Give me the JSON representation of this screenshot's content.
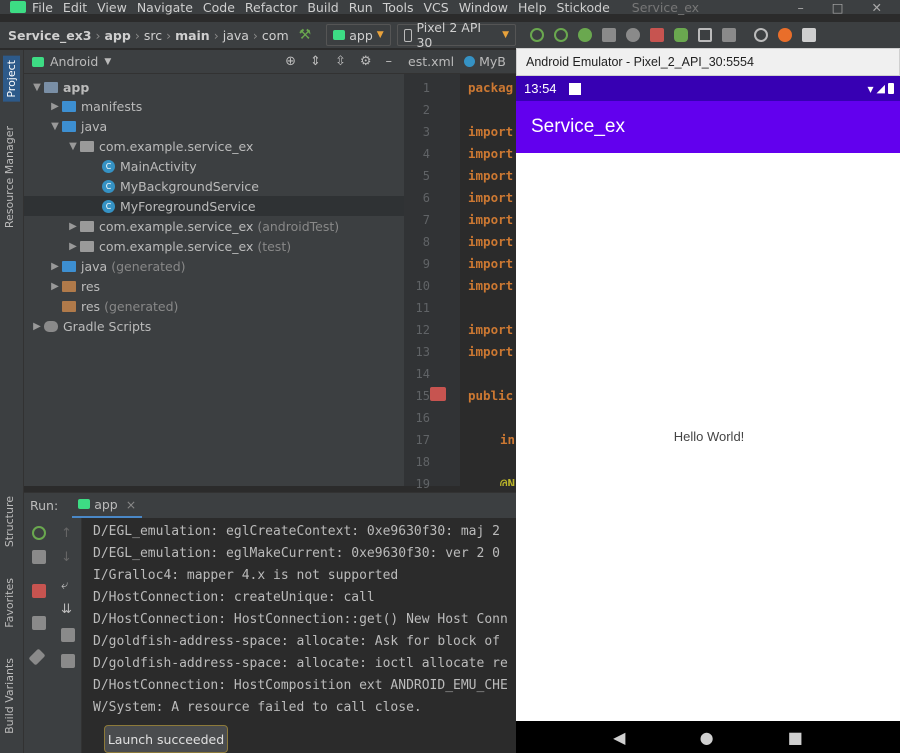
{
  "menu": {
    "items": [
      "File",
      "Edit",
      "View",
      "Navigate",
      "Code",
      "Refactor",
      "Build",
      "Run",
      "Tools",
      "VCS",
      "Window",
      "Help",
      "Stickode"
    ],
    "project_title": "Service_ex",
    "window_controls": [
      "–",
      "□",
      "✕"
    ]
  },
  "nav": {
    "crumbs": [
      "Service_ex3",
      "app",
      "src",
      "main",
      "java",
      "com"
    ],
    "run_config": "app",
    "device": "Pixel 2 API 30"
  },
  "left_stripe": {
    "project": "Project",
    "resource_manager": "Resource Manager",
    "structure": "Structure",
    "favorites": "Favorites",
    "build_variants": "Build Variants"
  },
  "project_pane": {
    "view_mode": "Android",
    "tree": [
      {
        "label": "app",
        "dim": ""
      },
      {
        "label": "manifests",
        "dim": ""
      },
      {
        "label": "java",
        "dim": ""
      },
      {
        "label": "com.example.service_ex",
        "dim": ""
      },
      {
        "label": "MainActivity",
        "dim": ""
      },
      {
        "label": "MyBackgroundService",
        "dim": ""
      },
      {
        "label": "MyForegroundService",
        "dim": ""
      },
      {
        "label": "com.example.service_ex",
        "dim": "(androidTest)"
      },
      {
        "label": "com.example.service_ex",
        "dim": "(test)"
      },
      {
        "label": "java",
        "dim": "(generated)"
      },
      {
        "label": "res",
        "dim": ""
      },
      {
        "label": "res",
        "dim": "(generated)"
      },
      {
        "label": "Gradle Scripts",
        "dim": ""
      }
    ]
  },
  "editor": {
    "tabs": [
      "est.xml",
      "MyB"
    ],
    "line_numbers": [
      "1",
      "2",
      "3",
      "4",
      "5",
      "6",
      "7",
      "8",
      "9",
      "10",
      "11",
      "12",
      "13",
      "14",
      "15",
      "16",
      "17",
      "18",
      "19"
    ],
    "code_fragments": {
      "l1": "packag",
      "l3": "import",
      "l4": "import",
      "l5": "import",
      "l6": "import",
      "l7": "import",
      "l8": "import",
      "l9": "import",
      "l10": "import",
      "l12": "import",
      "l13": "import",
      "l15": "public",
      "l17": "in",
      "l19": "@N"
    }
  },
  "run_panel": {
    "label": "Run:",
    "tab": "app",
    "close": "×",
    "log_lines": [
      "D/EGL_emulation: eglCreateContext: 0xe9630f30: maj 2",
      "D/EGL_emulation: eglMakeCurrent: 0xe9630f30: ver 2 0",
      "I/Gralloc4: mapper 4.x is not supported",
      "D/HostConnection: createUnique: call",
      "D/HostConnection: HostConnection::get() New Host Conn",
      "D/goldfish-address-space: allocate: Ask for block of",
      "D/goldfish-address-space: allocate: ioctl allocate re",
      "D/HostConnection: HostComposition ext ANDROID_EMU_CHE",
      "W/System: A resource failed to call close."
    ],
    "toast": "Launch succeeded"
  },
  "emulator": {
    "window_title": "Android Emulator - Pixel_2_API_30:5554",
    "time": "13:54",
    "app_title": "Service_ex",
    "body_text": "Hello World!",
    "nav_buttons": [
      "◀",
      "●",
      "■"
    ]
  },
  "colors": {
    "status_bar": "#3700b3",
    "app_bar": "#6200ee",
    "ide_panel": "#3c3f41",
    "editor_bg": "#2b2b2b",
    "keyword": "#cc7832"
  }
}
